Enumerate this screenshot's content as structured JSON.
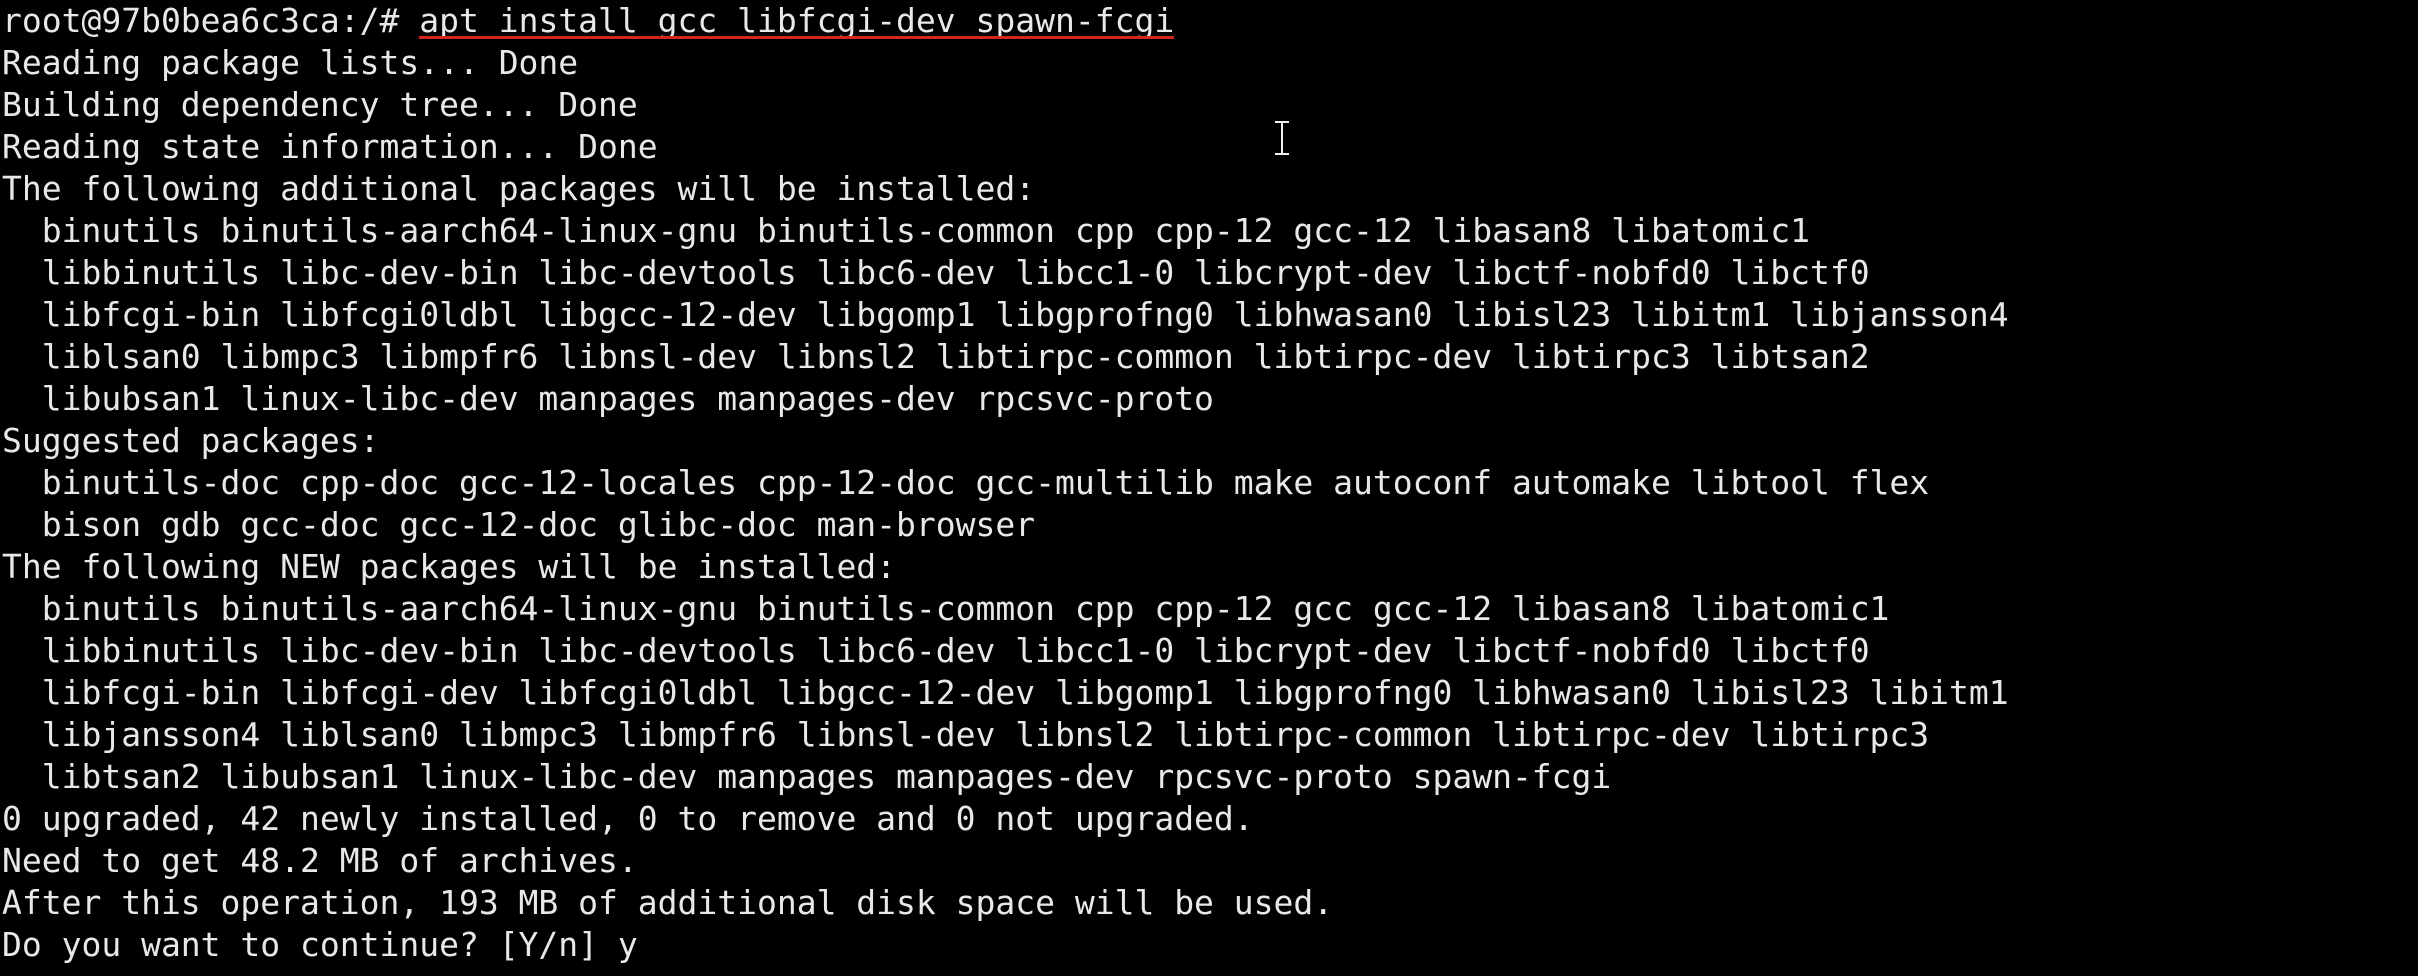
{
  "terminal": {
    "prompt": "root@97b0bea6c3ca:/# ",
    "command": "apt install gcc libfcgi-dev spawn-fcgi",
    "output": [
      "Reading package lists... Done",
      "Building dependency tree... Done",
      "Reading state information... Done",
      "The following additional packages will be installed:",
      "  binutils binutils-aarch64-linux-gnu binutils-common cpp cpp-12 gcc-12 libasan8 libatomic1",
      "  libbinutils libc-dev-bin libc-devtools libc6-dev libcc1-0 libcrypt-dev libctf-nobfd0 libctf0",
      "  libfcgi-bin libfcgi0ldbl libgcc-12-dev libgomp1 libgprofng0 libhwasan0 libisl23 libitm1 libjansson4",
      "  liblsan0 libmpc3 libmpfr6 libnsl-dev libnsl2 libtirpc-common libtirpc-dev libtirpc3 libtsan2",
      "  libubsan1 linux-libc-dev manpages manpages-dev rpcsvc-proto",
      "Suggested packages:",
      "  binutils-doc cpp-doc gcc-12-locales cpp-12-doc gcc-multilib make autoconf automake libtool flex",
      "  bison gdb gcc-doc gcc-12-doc glibc-doc man-browser",
      "The following NEW packages will be installed:",
      "  binutils binutils-aarch64-linux-gnu binutils-common cpp cpp-12 gcc gcc-12 libasan8 libatomic1",
      "  libbinutils libc-dev-bin libc-devtools libc6-dev libcc1-0 libcrypt-dev libctf-nobfd0 libctf0",
      "  libfcgi-bin libfcgi-dev libfcgi0ldbl libgcc-12-dev libgomp1 libgprofng0 libhwasan0 libisl23 libitm1",
      "  libjansson4 liblsan0 libmpc3 libmpfr6 libnsl-dev libnsl2 libtirpc-common libtirpc-dev libtirpc3",
      "  libtsan2 libubsan1 linux-libc-dev manpages manpages-dev rpcsvc-proto spawn-fcgi",
      "0 upgraded, 42 newly installed, 0 to remove and 0 not upgraded.",
      "Need to get 48.2 MB of archives.",
      "After this operation, 193 MB of additional disk space will be used.",
      "Do you want to continue? [Y/n] y"
    ]
  },
  "colors": {
    "background": "#000000",
    "text": "#e8e8e8",
    "underline": "#d2261e"
  }
}
